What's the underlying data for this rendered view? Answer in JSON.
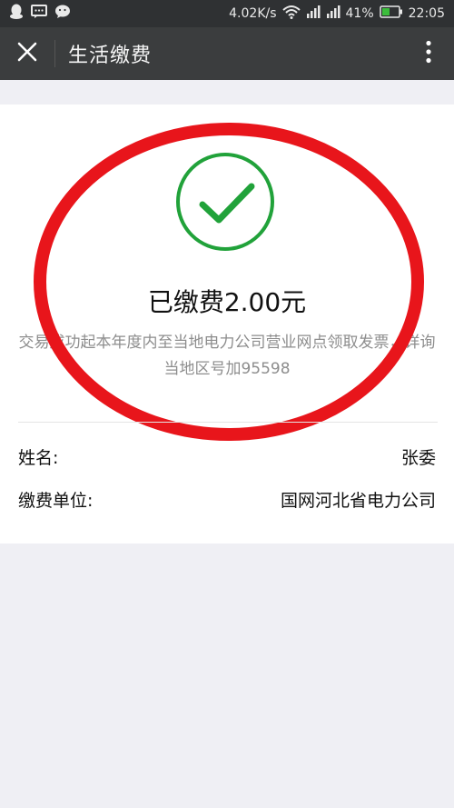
{
  "status_bar": {
    "speed": "4.02K/s",
    "battery": "41%",
    "time": "22:05",
    "icons": [
      "qq-icon",
      "message-icon",
      "wechat-icon",
      "wifi-icon",
      "signal-icon",
      "signal-icon",
      "battery-icon"
    ]
  },
  "header": {
    "title": "生活缴费",
    "close_icon": "close-icon",
    "menu_icon": "more-vertical-icon"
  },
  "result": {
    "status_icon": "check-circle-icon",
    "paid_text": "已缴费2.00元",
    "notice_line1": "交易成功起本年度内至当地电力公司营业网点领取发票，详询",
    "notice_line2": "当地区号加95598"
  },
  "details": {
    "name_label": "姓名:",
    "name_value": "张委",
    "unit_label": "缴费单位:",
    "unit_value": "国网河北省电力公司"
  },
  "colors": {
    "accent_green": "#21a23a",
    "annotation_red": "#e8151b",
    "header_bg": "#3b3d3e",
    "statusbar_bg": "#2f3133",
    "battery_green": "#3cbd3c"
  }
}
